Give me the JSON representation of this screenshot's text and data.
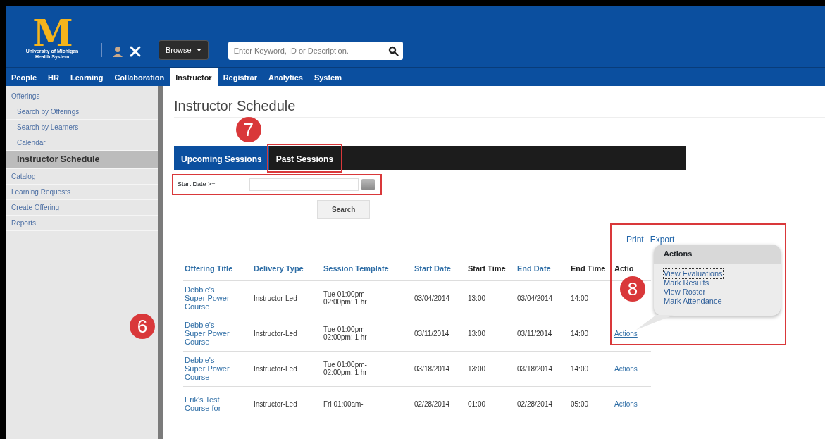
{
  "logo": {
    "letter": "M",
    "lines": [
      "University of Michigan",
      "Health System"
    ]
  },
  "header": {
    "browse_button": "Browse",
    "search": {
      "placeholder": "Enter Keyword, ID or Description."
    }
  },
  "nav_tabs": [
    {
      "label": "People",
      "selected": false
    },
    {
      "label": "HR",
      "selected": false
    },
    {
      "label": "Learning",
      "selected": false
    },
    {
      "label": "Collaboration",
      "selected": false
    },
    {
      "label": "Instructor",
      "selected": true
    },
    {
      "label": "Registrar",
      "selected": false
    },
    {
      "label": "Analytics",
      "selected": false
    },
    {
      "label": "System",
      "selected": false
    }
  ],
  "sidebar": {
    "items": [
      {
        "label": "Offerings",
        "selected": false,
        "children": [
          {
            "label": "Search by Offerings",
            "selected": false
          },
          {
            "label": "Search by Learners",
            "selected": false
          },
          {
            "label": "Calendar",
            "selected": false
          },
          {
            "label": "Instructor Schedule",
            "selected": true
          }
        ]
      },
      {
        "label": "Catalog",
        "selected": false
      },
      {
        "label": "Learning Requests",
        "selected": false
      },
      {
        "label": "Create Offering",
        "selected": false
      },
      {
        "label": "Reports",
        "selected": false
      }
    ]
  },
  "page_title": "Instructor Schedule",
  "session_tabs": [
    {
      "label": "Upcoming Sessions",
      "selected": true
    },
    {
      "label": "Past Sessions",
      "selected": false
    }
  ],
  "filter": {
    "label": "Start Date >="
  },
  "search_button": "Search",
  "links": [
    "Print",
    "Export"
  ],
  "table": {
    "columns": [
      {
        "label": "Offering Title",
        "sortable": true
      },
      {
        "label": "Delivery Type",
        "sortable": true
      },
      {
        "label": "Session Template",
        "sortable": true
      },
      {
        "label": "Start Date",
        "sortable": true
      },
      {
        "label": "Start Time",
        "sortable": false
      },
      {
        "label": "End Date",
        "sortable": true
      },
      {
        "label": "End Time",
        "sortable": false
      },
      {
        "label": "Actio",
        "sortable": false
      }
    ],
    "rows": [
      {
        "cells": [
          "Debbie's Super Power Course",
          "Instructor-Led",
          "Tue 01:00pm-02:00pm: 1 hr",
          "03/04/2014",
          "13:00",
          "03/04/2014",
          "14:00"
        ]
      },
      {
        "cells": [
          "Debbie's Super Power Course",
          "Instructor-Led",
          "Tue 01:00pm-02:00pm: 1 hr",
          "03/11/2014",
          "13:00",
          "03/11/2014",
          "14:00"
        ],
        "action": "Actions"
      },
      {
        "cells": [
          "Debbie's Super Power Course",
          "Instructor-Led",
          "Tue 01:00pm-02:00pm: 1 hr",
          "03/18/2014",
          "13:00",
          "03/18/2014",
          "14:00"
        ],
        "action": "Actions"
      },
      {
        "cells": [
          "Erik's Test Course for",
          "Instructor-Led",
          "Fri 01:00am-",
          "02/28/2014",
          "01:00",
          "02/28/2014",
          "05:00"
        ],
        "action": "Actions"
      }
    ]
  },
  "actions_popup": {
    "title": "Actions",
    "items": [
      {
        "label": "View Evaluations",
        "focused": true
      },
      {
        "label": "Mark Results",
        "focused": false
      },
      {
        "label": "View Roster",
        "focused": false
      },
      {
        "label": "Mark Attendance",
        "focused": false
      }
    ]
  },
  "callouts": [
    "6",
    "7",
    "8"
  ]
}
